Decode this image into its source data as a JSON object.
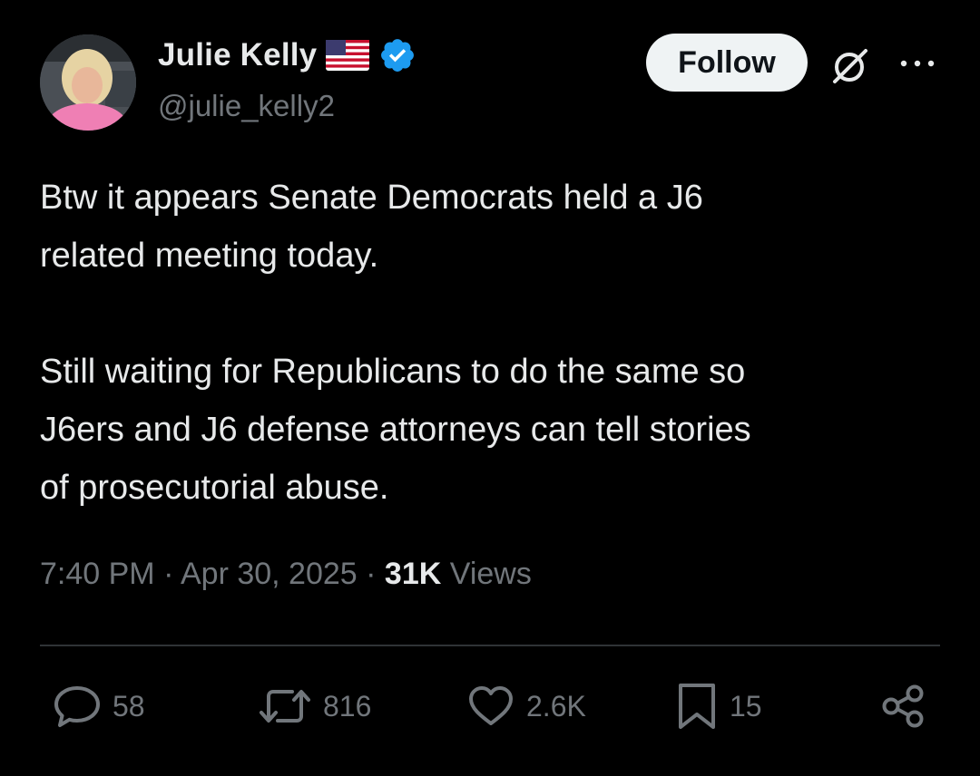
{
  "author": {
    "name": "Julie Kelly",
    "handle": "@julie_kelly2",
    "flag_icon": "us-flag-icon",
    "verified_icon": "verified-badge-icon",
    "verified_color": "#1d9bf0"
  },
  "header": {
    "follow_label": "Follow",
    "grok_icon": "grok-icon",
    "more_icon": "more-options-icon"
  },
  "tweet": {
    "text": "Btw it appears Senate Democrats held a J6\nrelated meeting today.\n\nStill waiting for Republicans to do the same so\nJ6ers and J6 defense attorneys can tell stories\nof prosecutorial abuse.",
    "time": "7:40 PM",
    "date": "Apr 30, 2025",
    "views_count": "31K",
    "views_label": "Views"
  },
  "actions": {
    "replies": "58",
    "reposts": "816",
    "likes": "2.6K",
    "bookmarks": "15"
  },
  "colors": {
    "background": "#000000",
    "text": "#e7e9ea",
    "secondary": "#71767b",
    "divider": "#2f3336",
    "follow_bg": "#eff3f4"
  }
}
